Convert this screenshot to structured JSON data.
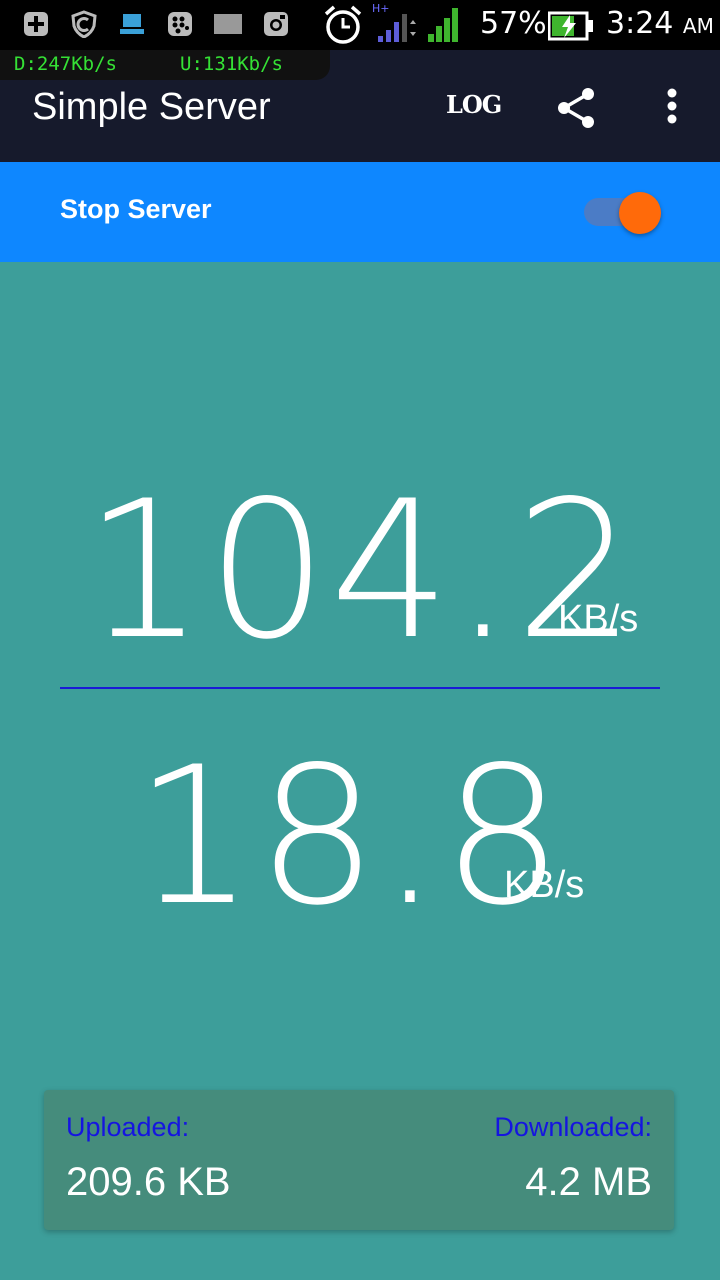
{
  "statusbar": {
    "battery": "57%",
    "time": "3:24",
    "ampm": "AM",
    "network_type": "H+"
  },
  "netmeter": {
    "download": "D:247Kb/s",
    "upload": "U:131Kb/s"
  },
  "appbar": {
    "title": "Simple Server",
    "log_label": "LOG"
  },
  "toggle": {
    "label": "Stop Server",
    "checked": true
  },
  "speeds": {
    "primary_value": "104.2",
    "primary_unit": "KB/s",
    "secondary_value": "18.8",
    "secondary_unit": "KB/s"
  },
  "summary": {
    "uploaded_label": "Uploaded:",
    "uploaded_value": "209.6 KB",
    "downloaded_label": "Downloaded:",
    "downloaded_value": "4.2 MB"
  },
  "colors": {
    "background": "#3d9e9a",
    "appbar": "#161a2c",
    "togglebar": "#0e87ff",
    "switch_thumb": "#ff6a0a",
    "divider": "#1a1ad6",
    "card_label": "#1515e0"
  },
  "icons": [
    "add-icon",
    "shield-icon",
    "monitor-icon",
    "blackberry-icon",
    "ss-icon",
    "instagram-icon",
    "alarm-icon",
    "signal-icon",
    "battery-icon",
    "share-icon",
    "more-vert-icon"
  ]
}
